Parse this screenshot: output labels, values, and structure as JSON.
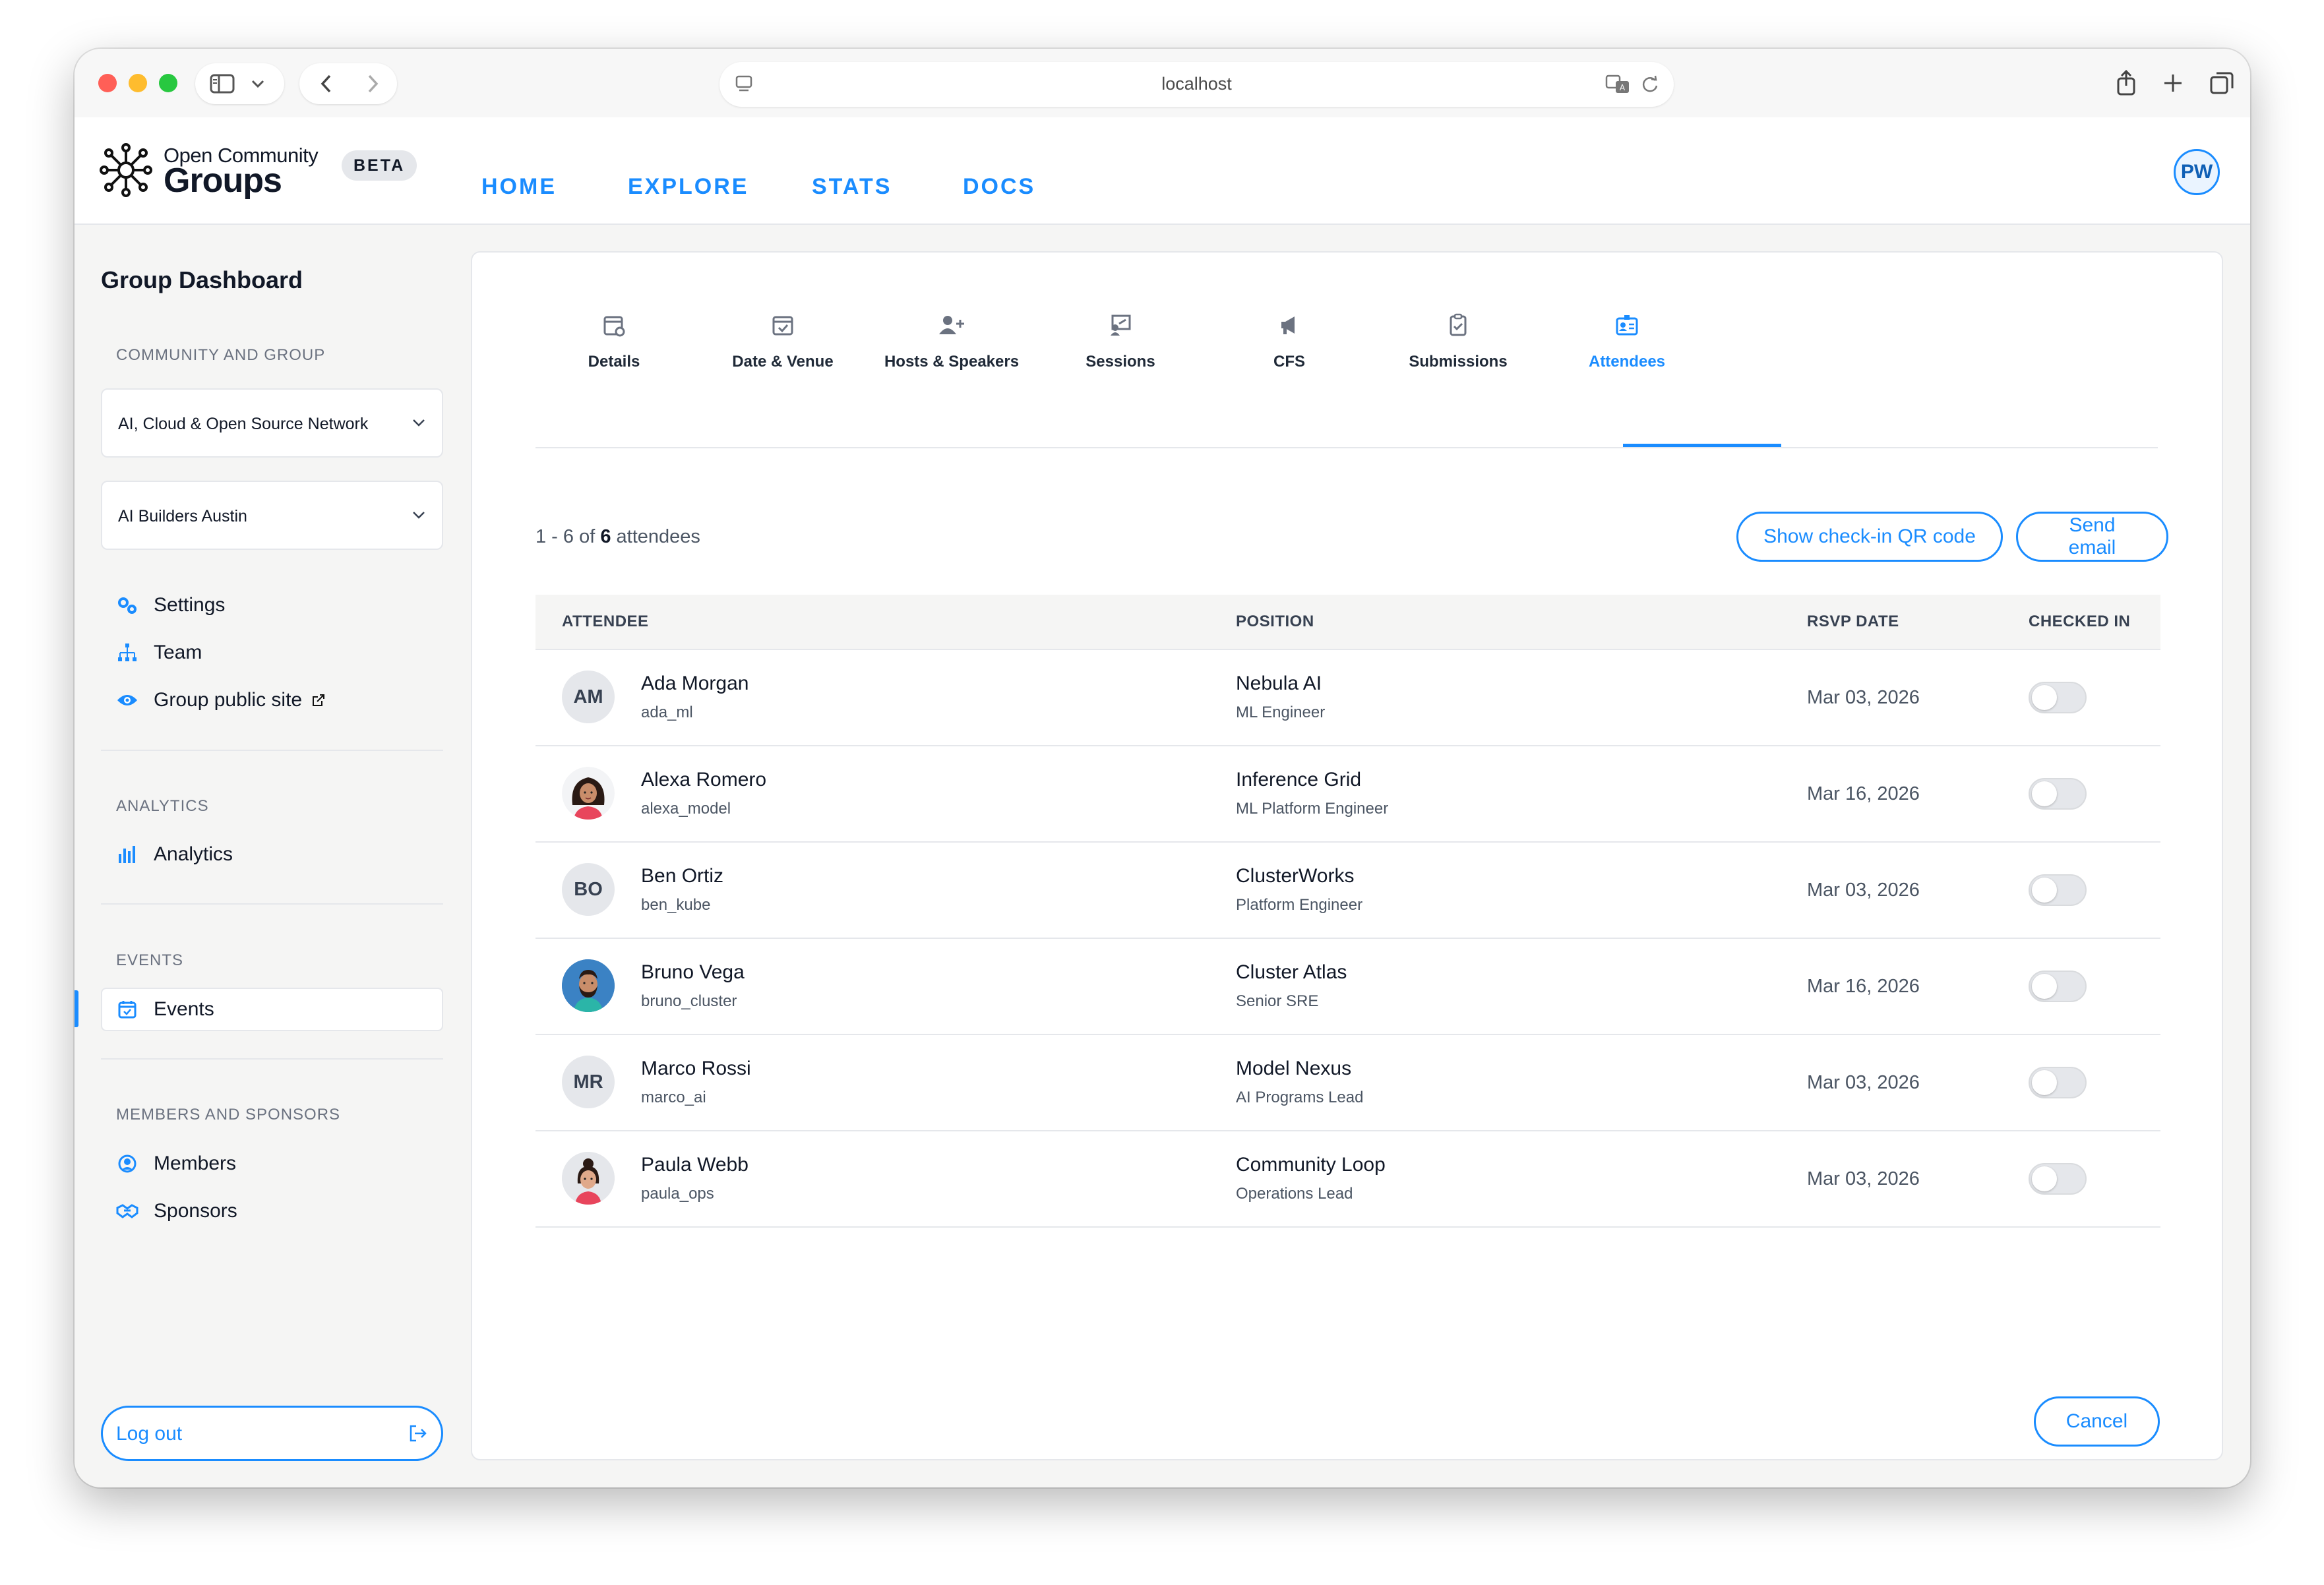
{
  "browser": {
    "url": "localhost"
  },
  "site": {
    "logo_small": "Open Community",
    "logo_big": "Groups",
    "beta": "BETA",
    "nav": [
      "HOME",
      "EXPLORE",
      "STATS",
      "DOCS"
    ],
    "user_initials": "PW",
    "accent_color": "#1a8cff"
  },
  "sidebar": {
    "title": "Group Dashboard",
    "section_community": "COMMUNITY AND GROUP",
    "community_select": "AI, Cloud & Open Source Network",
    "group_select": "AI Builders Austin",
    "items_group": [
      {
        "label": "Settings",
        "icon": "gears-icon"
      },
      {
        "label": "Team",
        "icon": "org-chart-icon"
      },
      {
        "label": "Group public site",
        "icon": "eye-icon"
      }
    ],
    "section_analytics": "ANALYTICS",
    "analytics_label": "Analytics",
    "section_events": "EVENTS",
    "events_label": "Events",
    "section_members": "MEMBERS AND SPONSORS",
    "members_label": "Members",
    "sponsors_label": "Sponsors",
    "logout_label": "Log out"
  },
  "tabs": [
    {
      "label": "Details",
      "icon": "calendar-gear-icon",
      "active": false
    },
    {
      "label": "Date & Venue",
      "icon": "calendar-check-icon",
      "active": false
    },
    {
      "label": "Hosts & Speakers",
      "icon": "user-plus-icon",
      "active": false
    },
    {
      "label": "Sessions",
      "icon": "presentation-icon",
      "active": false
    },
    {
      "label": "CFS",
      "icon": "megaphone-icon",
      "active": false
    },
    {
      "label": "Submissions",
      "icon": "clipboard-check-icon",
      "active": false
    },
    {
      "label": "Attendees",
      "icon": "id-badge-icon",
      "active": true
    }
  ],
  "attendees": {
    "count_prefix": "1 - 6 of ",
    "count_total": "6",
    "count_suffix": " attendees",
    "qr_button": "Show check-in QR code",
    "email_button": "Send email",
    "columns": {
      "attendee": "ATTENDEE",
      "position": "POSITION",
      "rsvp": "RSVP DATE",
      "checked_in": "CHECKED IN"
    },
    "rows": [
      {
        "initials": "AM",
        "name": "Ada Morgan",
        "username": "ada_ml",
        "company": "Nebula AI",
        "title": "ML Engineer",
        "rsvp": "Mar 03, 2026",
        "checked_in": false
      },
      {
        "initials": "",
        "name": "Alexa Romero",
        "username": "alexa_model",
        "company": "Inference Grid",
        "title": "ML Platform Engineer",
        "rsvp": "Mar 16, 2026",
        "checked_in": false
      },
      {
        "initials": "BO",
        "name": "Ben Ortiz",
        "username": "ben_kube",
        "company": "ClusterWorks",
        "title": "Platform Engineer",
        "rsvp": "Mar 03, 2026",
        "checked_in": false
      },
      {
        "initials": "",
        "name": "Bruno Vega",
        "username": "bruno_cluster",
        "company": "Cluster Atlas",
        "title": "Senior SRE",
        "rsvp": "Mar 16, 2026",
        "checked_in": false
      },
      {
        "initials": "MR",
        "name": "Marco Rossi",
        "username": "marco_ai",
        "company": "Model Nexus",
        "title": "AI Programs Lead",
        "rsvp": "Mar 03, 2026",
        "checked_in": false
      },
      {
        "initials": "",
        "name": "Paula Webb",
        "username": "paula_ops",
        "company": "Community Loop",
        "title": "Operations Lead",
        "rsvp": "Mar 03, 2026",
        "checked_in": false
      }
    ],
    "cancel_button": "Cancel"
  }
}
